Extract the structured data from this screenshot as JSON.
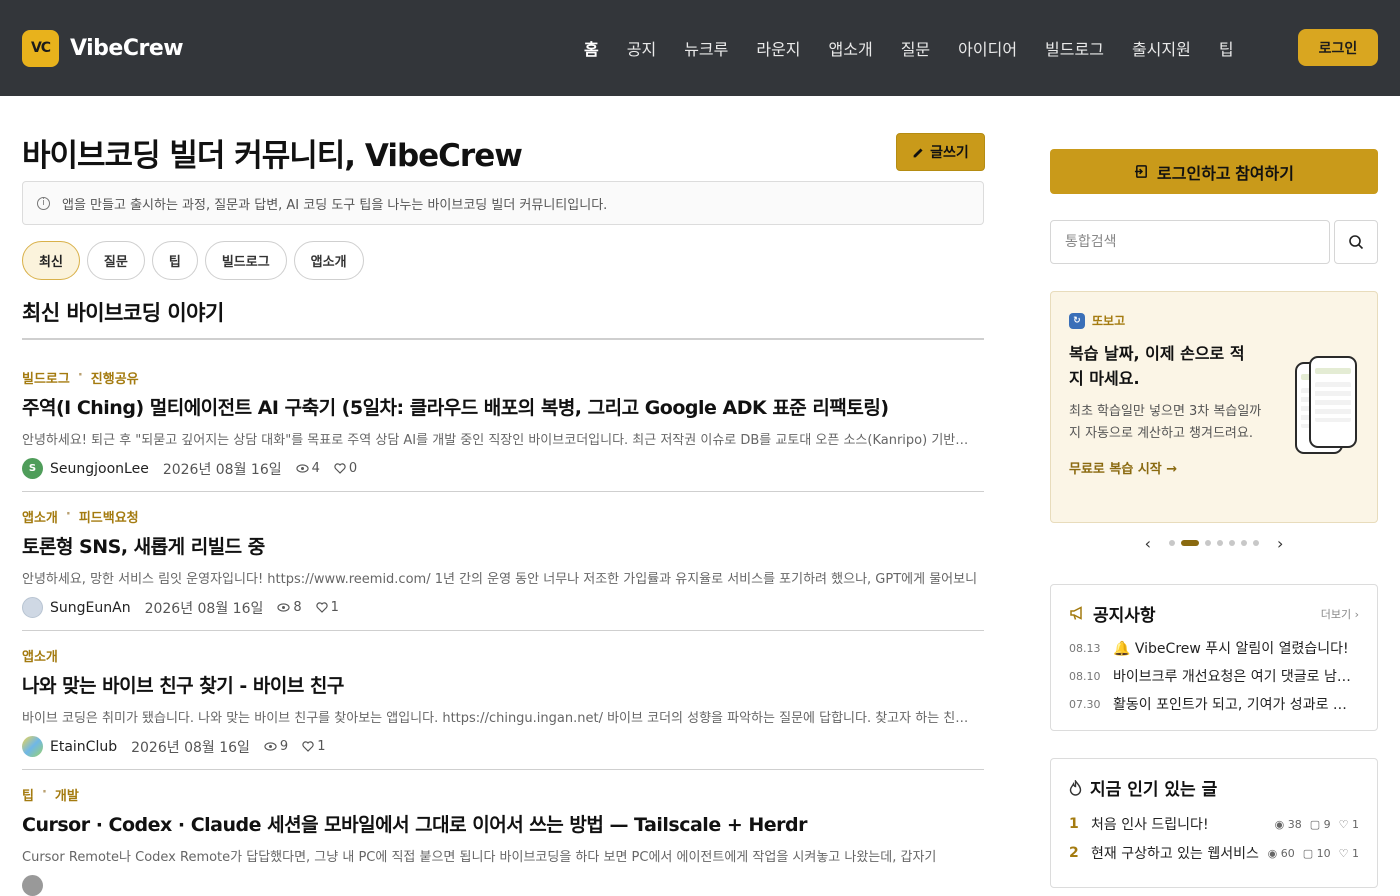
{
  "header": {
    "logo_mark": "VC",
    "logo_text": "VibeCrew",
    "nav": [
      "홈",
      "공지",
      "뉴크루",
      "라운지",
      "앱소개",
      "질문",
      "아이디어",
      "빌드로그",
      "출시지원",
      "팁"
    ],
    "login_label": "로그인",
    "accent": "#d9a620"
  },
  "main": {
    "title": "바이브코딩 빌더 커뮤니티, VibeCrew",
    "write_label": "글쓰기",
    "info": "앱을 만들고 출시하는 과정, 질문과 답변, AI 코딩 도구 팁을 나누는 바이브코딩 빌더 커뮤니티입니다.",
    "chips": [
      "최신",
      "질문",
      "팁",
      "빌드로그",
      "앱소개"
    ],
    "section_title": "최신 바이브코딩 이야기",
    "posts": [
      {
        "cat1": "빌드로그",
        "cat2": "진행공유",
        "title": "주역(I Ching) 멀티에이전트 AI 구축기 (5일차: 클라우드 배포의 복병, 그리고 Google ADK 표준 리팩토링)",
        "excerpt": "안녕하세요! 퇴근 후 \"되묻고 깊어지는 상담 대화\"를 목표로 주역 상담 AI를 개발 중인 직장인 바이브코더입니다. 최근 저작권 이슈로 DB를 교토대 오픈 소스(Kanripo) 기반으로 전면 교체하고",
        "author": "SeungjoonLee",
        "avatar": "S",
        "date": "2026년 08월 16일",
        "views": "4",
        "likes": "0"
      },
      {
        "cat1": "앱소개",
        "cat2": "피드백요청",
        "title": "토론형 SNS, 새롭게 리빌드 중",
        "excerpt": "안녕하세요, 망한 서비스 림잇 운영자입니다! https://www.reemid.com/ 1년 간의 운영 동안 너무나 저조한 가입률과 유지율로 서비스를 포기하려 했으나, GPT에게 물어보니",
        "author": "SungEunAn",
        "avatar": "",
        "date": "2026년 08월 16일",
        "views": "8",
        "likes": "1"
      },
      {
        "cat1": "앱소개",
        "cat2": "",
        "title": "나와 맞는 바이브 친구 찾기 - 바이브 친구",
        "excerpt": "바이브 코딩은 취미가 됐습니다. 나와 맞는 바이브 친구를 찾아보는 앱입니다. https://chingu.ingan.net/ 바이브 코더의 성향을 파악하는 질문에 답합니다. 찾고자 하는 친구 유형을",
        "author": "EtainClub",
        "avatar": "",
        "date": "2026년 08월 16일",
        "views": "9",
        "likes": "1"
      },
      {
        "cat1": "팁",
        "cat2": "개발",
        "title": "Cursor · Codex · Claude 세션을 모바일에서 그대로 이어서 쓰는 방법 — Tailscale + Herdr",
        "excerpt": "Cursor Remote나 Codex Remote가 답답했다면, 그냥 내 PC에 직접 붙으면 됩니다 바이브코딩을 하다 보면 PC에서 에이전트에게 작업을 시켜놓고 나왔는데, 갑자기",
        "author": "",
        "avatar": "",
        "date": "",
        "views": "",
        "likes": ""
      }
    ]
  },
  "sidebar": {
    "join_label": "로그인하고 참여하기",
    "search_placeholder": "통합검색",
    "promo": {
      "brand": "또보고",
      "headline": "복습 날짜, 이제 손으로 적지 마세요.",
      "desc": "최초 학습일만 넣으면 3차 복습일까지 자동으로 계산하고 챙겨드려요.",
      "link": "무료로 복습 시작 →"
    },
    "notices": {
      "title": "공지사항",
      "more": "더보기 ›",
      "items": [
        {
          "date": "08.13",
          "text": "🔔 VibeCrew 푸시 알림이 열렸습니다!"
        },
        {
          "date": "08.10",
          "text": "바이브크루 개선요청은 여기 댓글로 남겨주세요"
        },
        {
          "date": "07.30",
          "text": "활동이 포인트가 되고, 기여가 성과로 이어집니다"
        }
      ]
    },
    "popular": {
      "title": "지금 인기 있는 글",
      "items": [
        {
          "rank": "1",
          "text": "처음 인사 드립니다!",
          "views": "38",
          "comments": "9",
          "likes": "1"
        },
        {
          "rank": "2",
          "text": "현재 구상하고 있는 웹서비스",
          "views": "60",
          "comments": "10",
          "likes": "1"
        }
      ]
    }
  }
}
